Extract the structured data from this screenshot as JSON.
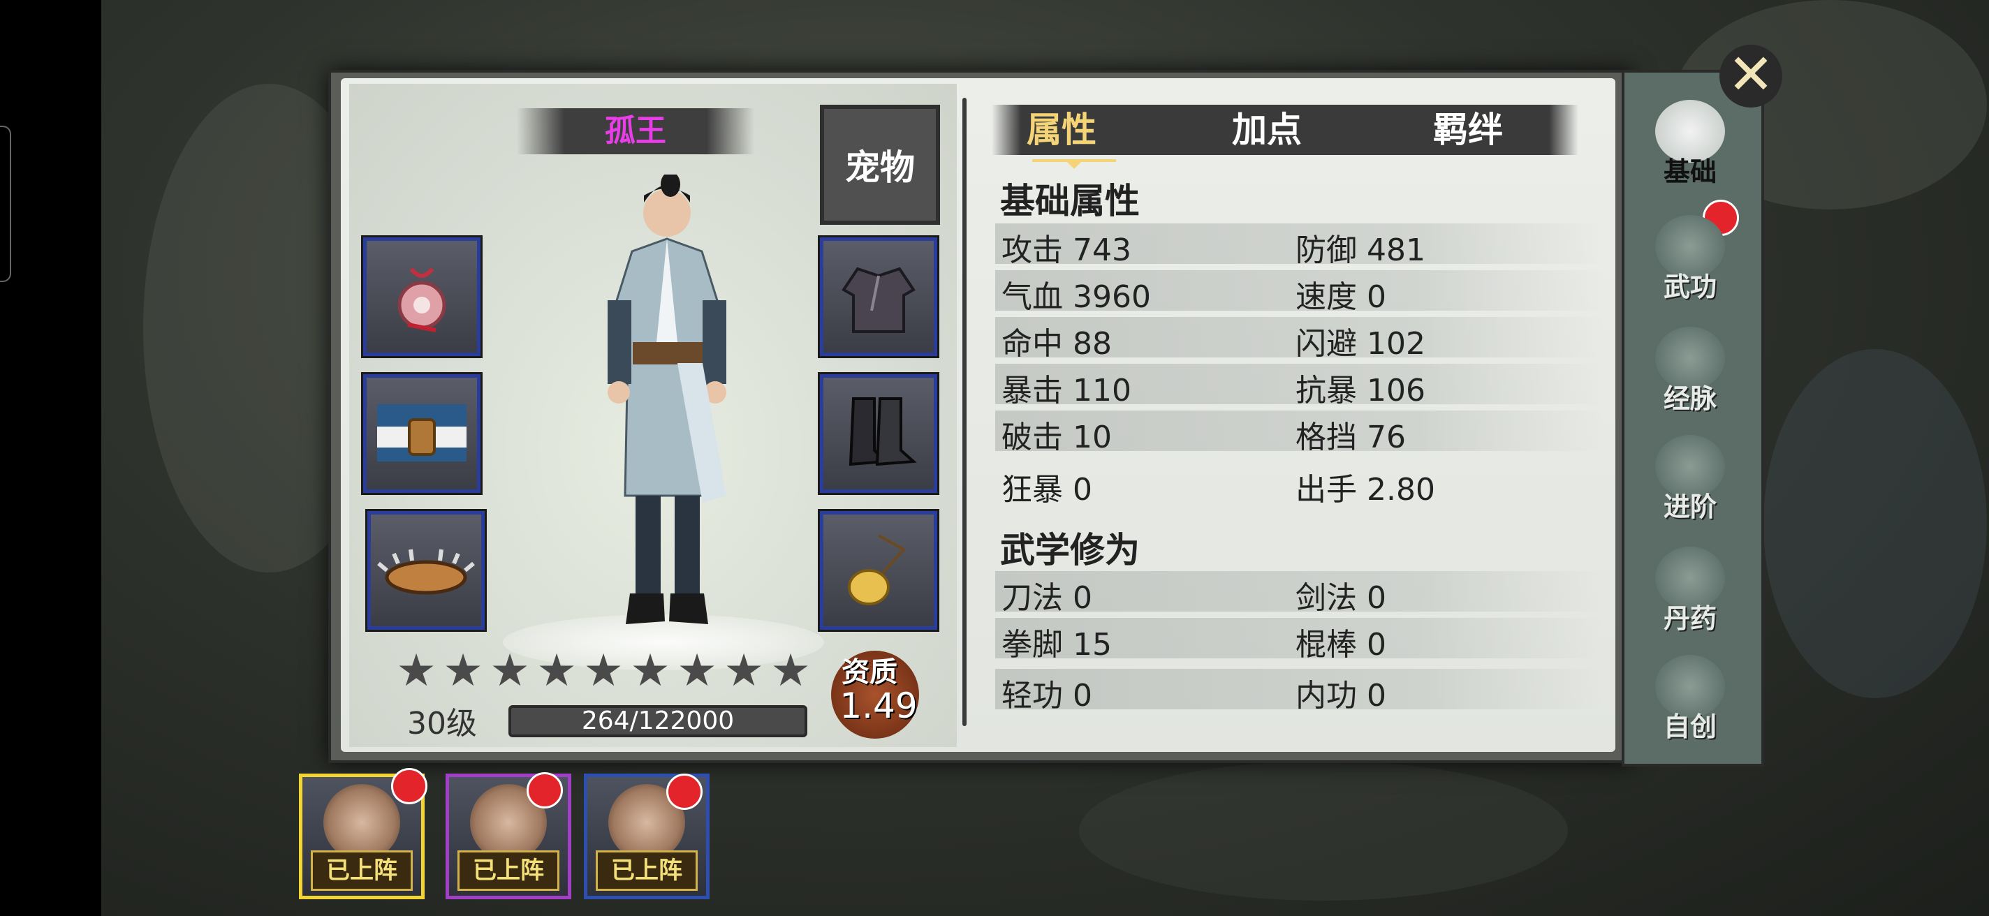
{
  "character": {
    "name": "孤王",
    "pet_label": "宠物",
    "level": "30级",
    "xp": "264/122000",
    "stars_filled": 0,
    "stars_total": 9,
    "aptitude_label": "资质",
    "aptitude_value": "1.49",
    "equipment_left": [
      "amulet",
      "belt",
      "bracers"
    ],
    "equipment_right": [
      "robe",
      "boots",
      "pendant"
    ]
  },
  "tabs": [
    {
      "label": "属性",
      "active": true
    },
    {
      "label": "加点",
      "active": false
    },
    {
      "label": "羁绊",
      "active": false
    }
  ],
  "basic_section": {
    "title": "基础属性",
    "rows": [
      {
        "l_label": "攻击",
        "l_value": "743",
        "r_label": "防御",
        "r_value": "481"
      },
      {
        "l_label": "气血",
        "l_value": "3960",
        "r_label": "速度",
        "r_value": "0"
      },
      {
        "l_label": "命中",
        "l_value": "88",
        "r_label": "闪避",
        "r_value": "102"
      },
      {
        "l_label": "暴击",
        "l_value": "110",
        "r_label": "抗暴",
        "r_value": "106"
      },
      {
        "l_label": "破击",
        "l_value": "10",
        "r_label": "格挡",
        "r_value": "76"
      },
      {
        "l_label": "狂暴",
        "l_value": "0",
        "r_label": "出手",
        "r_value": "2.80"
      }
    ]
  },
  "martial_section": {
    "title": "武学修为",
    "rows": [
      {
        "l_label": "刀法",
        "l_value": "0",
        "r_label": "剑法",
        "r_value": "0"
      },
      {
        "l_label": "拳脚",
        "l_value": "15",
        "r_label": "棍棒",
        "r_value": "0"
      },
      {
        "l_label": "轻功",
        "l_value": "0",
        "r_label": "内功",
        "r_value": "0"
      }
    ]
  },
  "side_nav": [
    {
      "label": "基础",
      "active": true,
      "badge": true
    },
    {
      "label": "武功",
      "active": false,
      "badge": false
    },
    {
      "label": "经脉",
      "active": false,
      "badge": false
    },
    {
      "label": "进阶",
      "active": false,
      "badge": false
    },
    {
      "label": "丹药",
      "active": false,
      "badge": false
    },
    {
      "label": "自创",
      "active": false,
      "badge": false
    }
  ],
  "party": [
    {
      "label": "已上阵",
      "frame_color": "#f2d434",
      "badge": true
    },
    {
      "label": "已上阵",
      "frame_color": "#a23fc7",
      "badge": true
    },
    {
      "label": "已上阵",
      "frame_color": "#2f4fb0",
      "badge": true
    }
  ],
  "colors": {
    "name": "#e83ee8",
    "tab_active": "#f4d476",
    "badge": "#e3242b",
    "slot_border": "#2a3d9a"
  }
}
